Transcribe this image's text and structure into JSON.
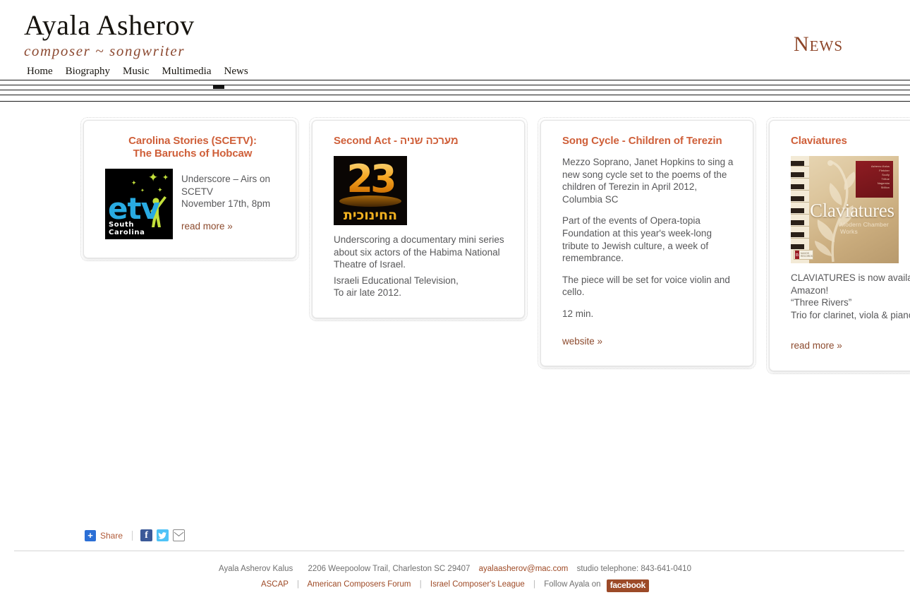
{
  "header": {
    "brand_name": "Ayala Asherov",
    "brand_tagline": "composer ~ songwriter",
    "page_title": "News"
  },
  "nav": {
    "items": [
      {
        "label": "Home",
        "active": false
      },
      {
        "label": "Biography",
        "active": false
      },
      {
        "label": "Music",
        "active": false
      },
      {
        "label": "Multimedia",
        "active": false
      },
      {
        "label": "News",
        "active": true
      }
    ]
  },
  "cards": [
    {
      "id": "carolina-stories",
      "title_line1": "Carolina Stories (SCETV):",
      "title_line2": "The Baruchs of Hobcaw",
      "image": {
        "name": "etv-south-carolina-logo",
        "text": "etv",
        "caption": "South Carolina"
      },
      "body_lines": [
        "Underscore – Airs on",
        "SCETV",
        "November 17th, 8pm"
      ],
      "link": "read more »"
    },
    {
      "id": "second-act",
      "title": "Second Act - מערכה שניה",
      "image": {
        "name": "israeli-educational-tv-channel-23-logo",
        "number": "23",
        "hebrew": "החינוכית"
      },
      "paragraphs": [
        "Underscoring a documentary mini series about six actors of the Habima National Theatre of Israel.",
        "Israeli Educational Television,",
        "To air late 2012."
      ]
    },
    {
      "id": "song-cycle-terezin",
      "title": "Song Cycle - Children of Terezin",
      "paragraphs": [
        "Mezzo Soprano, Janet Hopkins to sing a new song cycle set to the poems of the children of Terezin in April 2012, Columbia SC",
        "Part of the events of Opera-topia Foundation at this year's week-long tribute to Jewish culture, a week of remembrance.",
        "The piece will be set for voice violin and cello.",
        "12 min."
      ],
      "link": "website »"
    },
    {
      "id": "claviatures",
      "title": "Claviatures",
      "image": {
        "name": "claviatures-album-cover",
        "title": "Claviatures",
        "subtitle": "Modern Chamber Works",
        "composers": [
          "Asherov-Kalus",
          "Fletcher",
          "Scully",
          "Trittoe",
          "Nagorska",
          "Stillion"
        ],
        "label": "n"
      },
      "body_lines": [
        "CLAVIATURES is now available",
        "Amazon!",
        "“Three Rivers”",
        "Trio for clarinet, viola & piano"
      ],
      "link": "read more »"
    }
  ],
  "share": {
    "plus": "+",
    "label": "Share",
    "facebook": "f",
    "icons": [
      "facebook-icon",
      "twitter-icon",
      "email-icon"
    ]
  },
  "footer": {
    "name": "Ayala Asherov Kalus",
    "address": "2206 Weepoolow Trail, Charleston SC 29407",
    "email": "ayalaasherov@mac.com",
    "phone": "studio telephone: 843-641-0410",
    "links": [
      "ASCAP",
      "American Composers Forum",
      "Israel Composer's League"
    ],
    "follow_text": "Follow Ayala on",
    "facebook_badge": "facebook"
  },
  "colors": {
    "accent_orange": "#cf5f39",
    "accent_rust": "#8c4a2d",
    "brand_tag": "#8d4b33",
    "title_rust": "#8d4427",
    "body_gray": "#58585a",
    "footer_gray": "#707070"
  }
}
